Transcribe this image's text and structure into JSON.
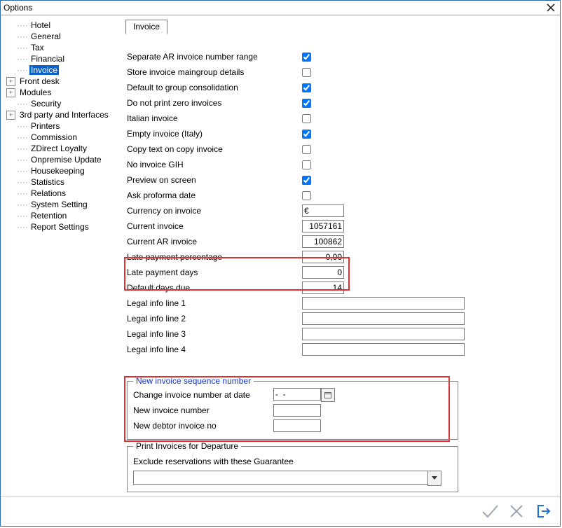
{
  "window_title": "Options",
  "tree": [
    {
      "label": "Hotel",
      "exp": ""
    },
    {
      "label": "General",
      "exp": ""
    },
    {
      "label": "Tax",
      "exp": ""
    },
    {
      "label": "Financial",
      "exp": ""
    },
    {
      "label": "Invoice",
      "exp": "",
      "selected": true
    },
    {
      "label": "Front desk",
      "exp": "+"
    },
    {
      "label": "Modules",
      "exp": "+"
    },
    {
      "label": "Security",
      "exp": ""
    },
    {
      "label": "3rd party and Interfaces",
      "exp": "+"
    },
    {
      "label": "Printers",
      "exp": ""
    },
    {
      "label": "Commission",
      "exp": ""
    },
    {
      "label": "ZDirect Loyalty",
      "exp": ""
    },
    {
      "label": "Onpremise Update",
      "exp": ""
    },
    {
      "label": "Housekeeping",
      "exp": ""
    },
    {
      "label": "Statistics",
      "exp": ""
    },
    {
      "label": "Relations",
      "exp": ""
    },
    {
      "label": "System Setting",
      "exp": ""
    },
    {
      "label": "Retention",
      "exp": ""
    },
    {
      "label": "Report Settings",
      "exp": ""
    }
  ],
  "tab_label": "Invoice",
  "checks": {
    "separate_ar": {
      "label": "Separate AR invoice number range",
      "checked": true
    },
    "store_maingroup": {
      "label": "Store invoice maingroup details",
      "checked": false
    },
    "default_group": {
      "label": "Default to group consolidation",
      "checked": true
    },
    "no_zero": {
      "label": "Do not print zero invoices",
      "checked": true
    },
    "italian": {
      "label": "Italian invoice",
      "checked": false
    },
    "empty_italy": {
      "label": "Empty invoice (Italy)",
      "checked": true
    },
    "copy_text": {
      "label": "Copy text on copy invoice",
      "checked": false
    },
    "no_gih": {
      "label": "No invoice GIH",
      "checked": false
    },
    "preview": {
      "label": "Preview on screen",
      "checked": true
    },
    "ask_proforma": {
      "label": "Ask proforma date",
      "checked": false
    }
  },
  "currency": {
    "label": "Currency on invoice",
    "value": "€"
  },
  "current_invoice": {
    "label": "Current invoice",
    "value": "1057161"
  },
  "current_ar": {
    "label": "Current AR invoice",
    "value": "100862"
  },
  "late_pct": {
    "label": "Late payment percentage",
    "value": "0,00"
  },
  "late_days": {
    "label": "Late payment days",
    "value": "0"
  },
  "default_due": {
    "label": "Default days due",
    "value": "14"
  },
  "legal1": {
    "label": "Legal info line 1",
    "value": ""
  },
  "legal2": {
    "label": "Legal info line 2",
    "value": ""
  },
  "legal3": {
    "label": "Legal info line 3",
    "value": ""
  },
  "legal4": {
    "label": "Legal info line 4",
    "value": ""
  },
  "gb1": {
    "title": "New invoice sequence number",
    "change_date": {
      "label": "Change invoice number at date",
      "value": "-  -"
    },
    "new_no": {
      "label": "New invoice number",
      "value": ""
    },
    "new_debtor": {
      "label": "New debtor invoice no",
      "value": ""
    }
  },
  "gb2": {
    "title": "Print Invoices for Departure",
    "exclude_label": "Exclude reservations with these Guarantee",
    "exclude_value": ""
  }
}
